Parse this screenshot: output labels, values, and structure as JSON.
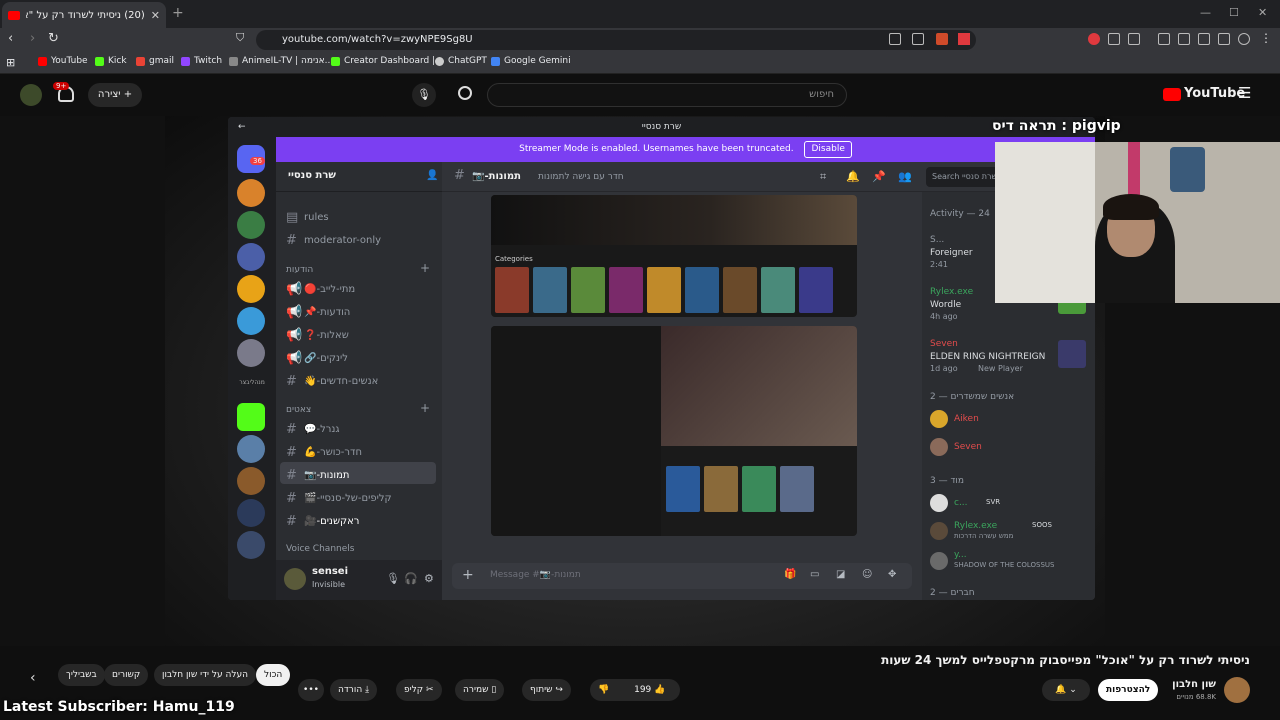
{
  "browser": {
    "tab_title": "(20) ניסיתי לשרוד רק על \"אוכל\" מפייסבוק מרקטפלייס למשך 24 שעות",
    "url": "youtube.com/watch?v=zwyNPE9Sg8U",
    "bookmarks": [
      "YouTube",
      "Kick",
      "gmail",
      "Twitch",
      "AnimeIL-TV | אנימה...",
      "Creator Dashboard |...",
      "ChatGPT",
      "Google Gemini"
    ]
  },
  "youtube": {
    "logo": "YouTube",
    "search_placeholder": "חיפוש",
    "create_label": "יצירה",
    "notif_count": "9+"
  },
  "discord": {
    "window_title": "שרת סנסיי",
    "streamer_banner": "Streamer Mode is enabled. Usernames have been truncated.",
    "disable_label": "Disable",
    "server_name": "שרת סנסיי",
    "server_badge": "36",
    "folder_label": "מנהליבצר",
    "channel_header": "📷-תמונות",
    "channel_topic": "חדר עם גישה לתמונות",
    "search_placeholder": "Search שרת סנסיי",
    "top_channels": [
      "rules",
      "moderator-only"
    ],
    "cat_news": "הודעות",
    "news_channels": [
      "🔴-מתי-לייב",
      "📌-הודעות",
      "❓-שאלות",
      "🔗-לינקים",
      "👋-אנשים-חדשים"
    ],
    "cat_chats": "צאטים",
    "chat_channels": [
      "💬-גנרל",
      "💪-חדר-כושר",
      "📷-תמונות",
      "🎬-קליפים-של-סנסיי",
      "🎥-ראקשנים"
    ],
    "voice_label": "Voice Channels",
    "user_name": "sensei",
    "user_status": "Invisible",
    "message_placeholder": "Message #📷-תמונות",
    "activity_header": "Activity — 24",
    "activity": [
      {
        "name": "S...",
        "game": "Foreigner",
        "meta": "2:41"
      },
      {
        "name": "Rylex.exe",
        "game": "Wordle",
        "meta": "4h ago"
      },
      {
        "name": "Seven",
        "game": "ELDEN RING NIGHTREIGN",
        "meta": "1d ago",
        "meta2": "New Player"
      }
    ],
    "streaming_header": "אנשים שמשדרים — 2",
    "streamers": [
      "Aiken",
      "Seven"
    ],
    "mods_header": "מוד — 3",
    "mods": [
      {
        "name": "c...",
        "tag": "SVR",
        "sub": ""
      },
      {
        "name": "Rylex.exe",
        "tag": "SOOS",
        "sub": "ממש עשרה הדרכות"
      },
      {
        "name": "y...",
        "tag": "",
        "sub": "SHADOW OF THE COLOSSUS"
      }
    ],
    "friends_header": "חברים — 2",
    "thumb_label": "Categories"
  },
  "stream": {
    "overlay_title": "תראה דיס : pigvip",
    "latest_sub": "Latest Subscriber: Hamu_119"
  },
  "video": {
    "title": "ניסיתי לשרוד רק על \"אוכל\" מפייסבוק מרקטפלייס למשך 24 שעות",
    "channel": "שון חלבון",
    "subs": "68.8K מנויים",
    "join": "להצטרפות",
    "likes": "199",
    "share": "שיתוף",
    "save": "שמירה",
    "clip": "קליפ",
    "download": "הורדה",
    "chips": [
      "הכול",
      "העלה על ידי שון חלבון",
      "קשורים",
      "בשביליך"
    ]
  },
  "colors": {
    "discord_bg": "#313338",
    "streamer_banner": "#7b3ff2",
    "yt_red": "#ff0000"
  }
}
